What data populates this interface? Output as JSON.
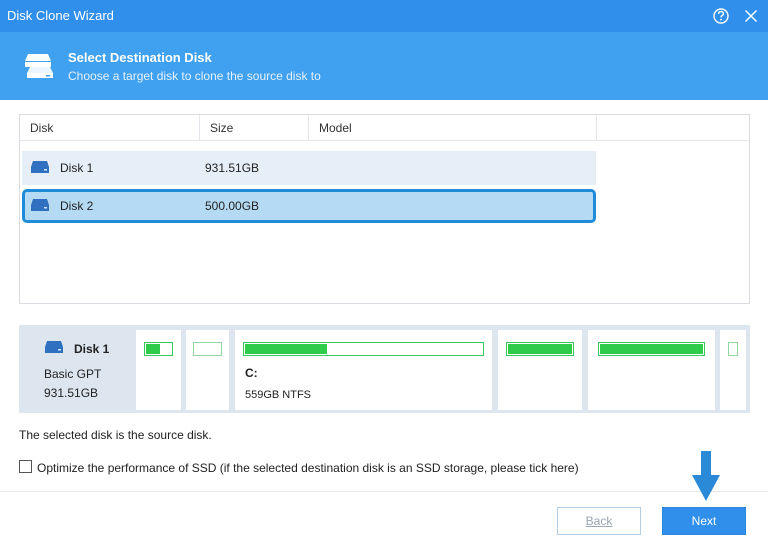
{
  "window": {
    "title": "Disk Clone Wizard",
    "accent_color": "#2f8fea",
    "controls": [
      "help-icon",
      "close-icon"
    ]
  },
  "header": {
    "title": "Select Destination Disk",
    "subtitle": "Choose a target disk to clone the source disk to",
    "icon": "disk-stack-icon"
  },
  "disk_table": {
    "columns": [
      "Disk",
      "Size",
      "Model"
    ],
    "rows": [
      {
        "disk": "Disk 1",
        "size": "931.51GB",
        "model": "",
        "selected": false
      },
      {
        "disk": "Disk 2",
        "size": "500.00GB",
        "model": "",
        "selected": true
      }
    ]
  },
  "disk_map": {
    "name": "Disk 1",
    "type": "Basic GPT",
    "capacity": "931.51GB",
    "partitions": [
      {
        "label": "",
        "info": "",
        "usage_percent": 60
      },
      {
        "label": "",
        "info": "",
        "usage_percent": 0
      },
      {
        "label": "C:",
        "info": "559GB NTFS",
        "usage_percent": 35
      },
      {
        "label": "",
        "info": "",
        "usage_percent": 100
      },
      {
        "label": "",
        "info": "",
        "usage_percent": 100
      },
      {
        "label": "",
        "info": "",
        "usage_percent": 0
      }
    ]
  },
  "status_message": "The selected disk is the source disk.",
  "ssd_option": {
    "label": "Optimize the performance of SSD (if the selected destination disk is an SSD storage, please tick here)",
    "checked": false
  },
  "buttons": {
    "back": "Back",
    "next": "Next"
  }
}
